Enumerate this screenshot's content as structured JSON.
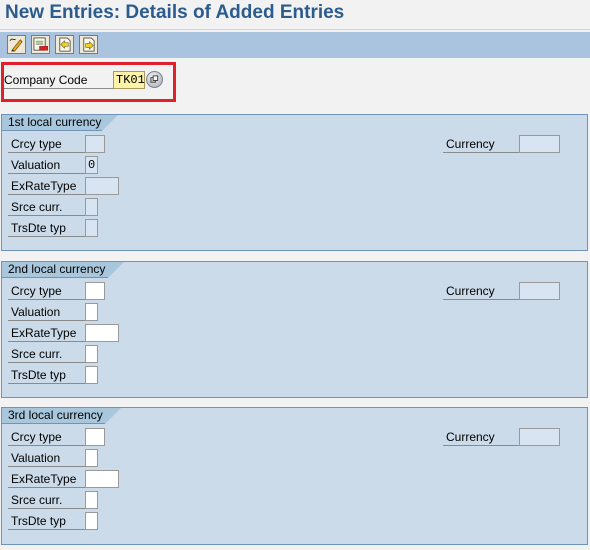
{
  "header": {
    "title": "New Entries: Details of Added Entries"
  },
  "toolbar": {
    "buttons": [
      {
        "name": "display-change-button",
        "icon": "pencil-glasses-icon"
      },
      {
        "name": "delete-button",
        "icon": "delete-entry-icon"
      },
      {
        "name": "previous-entry-button",
        "icon": "previous-entry-icon"
      },
      {
        "name": "next-entry-button",
        "icon": "next-entry-icon"
      }
    ]
  },
  "company_code": {
    "label": "Company Code",
    "value": "TK01",
    "help_icon": "possible-entries-icon"
  },
  "colors": {
    "title": "#2c5b8e",
    "toolbar": "#aac4df",
    "group_bg": "#ccdbe9",
    "highlight": "#e0202a",
    "required_field": "#fcf2a8"
  },
  "groups": [
    {
      "title": "1st local currency",
      "fields": [
        {
          "label": "Crcy type",
          "value": ""
        },
        {
          "label": "Valuation",
          "value": "0"
        },
        {
          "label": "ExRateType",
          "value": ""
        },
        {
          "label": "Srce curr.",
          "value": ""
        },
        {
          "label": "TrsDte typ",
          "value": ""
        }
      ],
      "currency": {
        "label": "Currency",
        "value": ""
      }
    },
    {
      "title": "2nd local currency",
      "fields": [
        {
          "label": "Crcy type",
          "value": ""
        },
        {
          "label": "Valuation",
          "value": ""
        },
        {
          "label": "ExRateType",
          "value": ""
        },
        {
          "label": "Srce curr.",
          "value": ""
        },
        {
          "label": "TrsDte typ",
          "value": ""
        }
      ],
      "currency": {
        "label": "Currency",
        "value": ""
      }
    },
    {
      "title": "3rd local currency",
      "fields": [
        {
          "label": "Crcy type",
          "value": ""
        },
        {
          "label": "Valuation",
          "value": ""
        },
        {
          "label": "ExRateType",
          "value": ""
        },
        {
          "label": "Srce curr.",
          "value": ""
        },
        {
          "label": "TrsDte typ",
          "value": ""
        }
      ],
      "currency": {
        "label": "Currency",
        "value": ""
      }
    }
  ]
}
